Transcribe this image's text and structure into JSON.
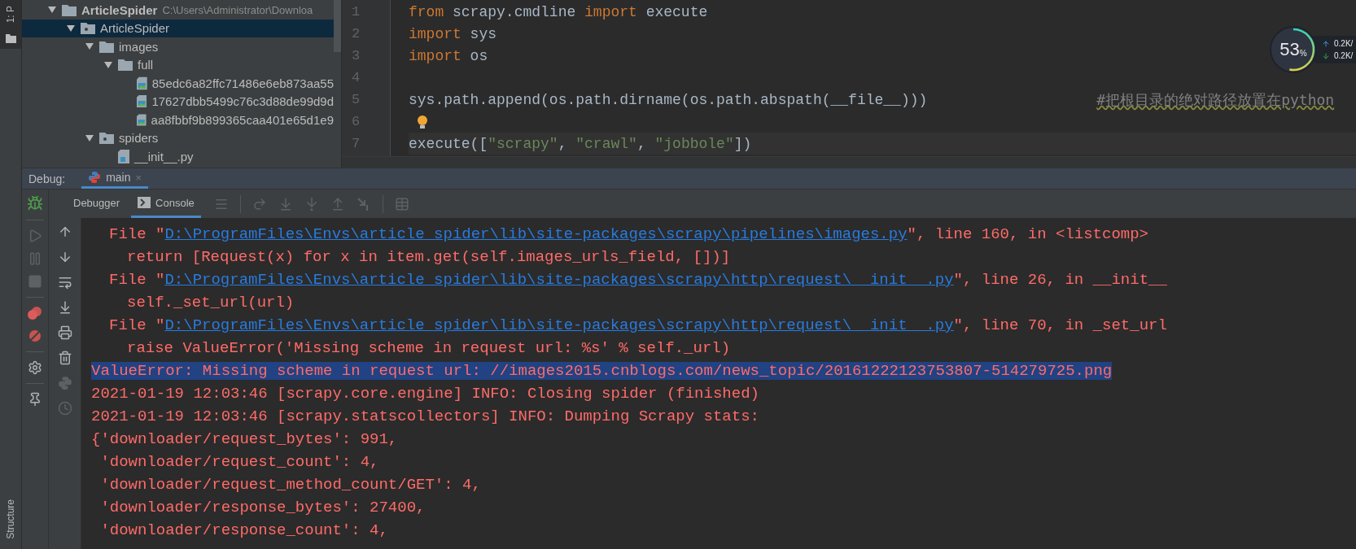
{
  "left_strip": {
    "top_tab": "1: P",
    "bottom_tab": "Structure"
  },
  "project_tree": [
    {
      "label": "ArticleSpider",
      "path": "C:\\Users\\Administrator\\Downloa",
      "kind": "folder",
      "expanded": true,
      "selected": false,
      "children": [
        {
          "label": "ArticleSpider",
          "kind": "package",
          "expanded": true,
          "selected": true,
          "children": [
            {
              "label": "images",
              "kind": "folder",
              "expanded": true,
              "selected": false,
              "children": [
                {
                  "label": "full",
                  "kind": "folder",
                  "expanded": true,
                  "selected": false,
                  "children": [
                    {
                      "label": "85edc6a82ffc71486e6eb873aa55",
                      "kind": "image",
                      "selected": false
                    },
                    {
                      "label": "17627dbb5499c76c3d88de99d9d",
                      "kind": "image",
                      "selected": false
                    },
                    {
                      "label": "aa8fbbf9b899365caa401e65d1e9",
                      "kind": "image",
                      "selected": false
                    }
                  ]
                }
              ]
            },
            {
              "label": "spiders",
              "kind": "package",
              "expanded": true,
              "selected": false,
              "children": [
                {
                  "label": "__init__.py",
                  "kind": "python",
                  "selected": false
                }
              ]
            }
          ]
        }
      ]
    }
  ],
  "editor": {
    "lines": [
      {
        "number": "1",
        "hint": false,
        "tokens": [
          {
            "text": "from",
            "kind": "keyword"
          },
          {
            "text": " scrapy.cmdline ",
            "kind": "plain"
          },
          {
            "text": "import",
            "kind": "keyword"
          },
          {
            "text": " execute",
            "kind": "plain"
          }
        ]
      },
      {
        "number": "2",
        "hint": false,
        "tokens": [
          {
            "text": "import",
            "kind": "keyword"
          },
          {
            "text": " sys",
            "kind": "plain"
          }
        ]
      },
      {
        "number": "3",
        "hint": false,
        "tokens": [
          {
            "text": "import",
            "kind": "keyword"
          },
          {
            "text": " os",
            "kind": "plain"
          }
        ]
      },
      {
        "number": "4",
        "hint": false
      },
      {
        "number": "5",
        "hint": false,
        "tokens": [
          {
            "text": "sys.path.append(os.path.dirname(os.path.abspath(__file__)))",
            "kind": "plain"
          },
          {
            "text": "#把根目录的绝对路径放置在python",
            "kind": "comment"
          }
        ]
      },
      {
        "number": "6",
        "hint": true
      },
      {
        "number": "7",
        "hint": false,
        "tokens": [
          {
            "text": "execute([",
            "kind": "plain"
          },
          {
            "text": "\"scrapy\"",
            "kind": "string"
          },
          {
            "text": ", ",
            "kind": "plain"
          },
          {
            "text": "\"crawl\"",
            "kind": "string"
          },
          {
            "text": ", ",
            "kind": "plain"
          },
          {
            "text": "\"jobbole\"",
            "kind": "string"
          },
          {
            "text": "])",
            "kind": "plain"
          }
        ]
      }
    ]
  },
  "monitor": {
    "percent": "53",
    "unit": "%",
    "level": 0.53,
    "upload": "0.2K/",
    "download": "0.2K/"
  },
  "debug": {
    "label": "Debug:",
    "tab": {
      "label": "main",
      "close": "×",
      "selected": true
    },
    "tool_tabs": [
      {
        "label": "Debugger",
        "selected": false
      },
      {
        "label": "Console",
        "selected": true
      }
    ]
  },
  "console": [
    {
      "kind": "file",
      "prefix": "File \"",
      "link": "D:\\ProgramFiles\\Envs\\article_spider\\lib\\site-packages\\scrapy\\pipelines\\images.py",
      "suffix": "\", line 160, in <listcomp>",
      "selected": false
    },
    {
      "kind": "code",
      "text": "return [Request(x) for x in item.get(self.images_urls_field, [])]",
      "selected": false
    },
    {
      "kind": "file",
      "prefix": "File \"",
      "link": "D:\\ProgramFiles\\Envs\\article_spider\\lib\\site-packages\\scrapy\\http\\request\\__init__.py",
      "suffix": "\", line 26, in __init__",
      "selected": false
    },
    {
      "kind": "code",
      "text": "self._set_url(url)",
      "selected": false
    },
    {
      "kind": "file",
      "prefix": "File \"",
      "link": "D:\\ProgramFiles\\Envs\\article_spider\\lib\\site-packages\\scrapy\\http\\request\\__init__.py",
      "suffix": "\", line 70, in _set_url",
      "selected": false
    },
    {
      "kind": "code",
      "text": "raise ValueError('Missing scheme in request url: %s' % self._url)",
      "selected": false
    },
    {
      "kind": "plain",
      "text": "ValueError: Missing scheme in request url: //images2015.cnblogs.com/news_topic/20161222123753807-514279725.png",
      "selected": true
    },
    {
      "kind": "plain",
      "text": "2021-01-19 12:03:46 [scrapy.core.engine] INFO: Closing spider (finished)",
      "selected": false
    },
    {
      "kind": "plain",
      "text": "2021-01-19 12:03:46 [scrapy.statscollectors] INFO: Dumping Scrapy stats:",
      "selected": false
    },
    {
      "kind": "plain",
      "text": "{'downloader/request_bytes': 991,",
      "selected": false
    },
    {
      "kind": "plain",
      "text": " 'downloader/request_count': 4,",
      "selected": false
    },
    {
      "kind": "plain",
      "text": " 'downloader/request_method_count/GET': 4,",
      "selected": false
    },
    {
      "kind": "plain",
      "text": " 'downloader/response_bytes': 27400,",
      "selected": false
    },
    {
      "kind": "plain",
      "text": " 'downloader/response_count': 4,",
      "selected": false
    }
  ]
}
